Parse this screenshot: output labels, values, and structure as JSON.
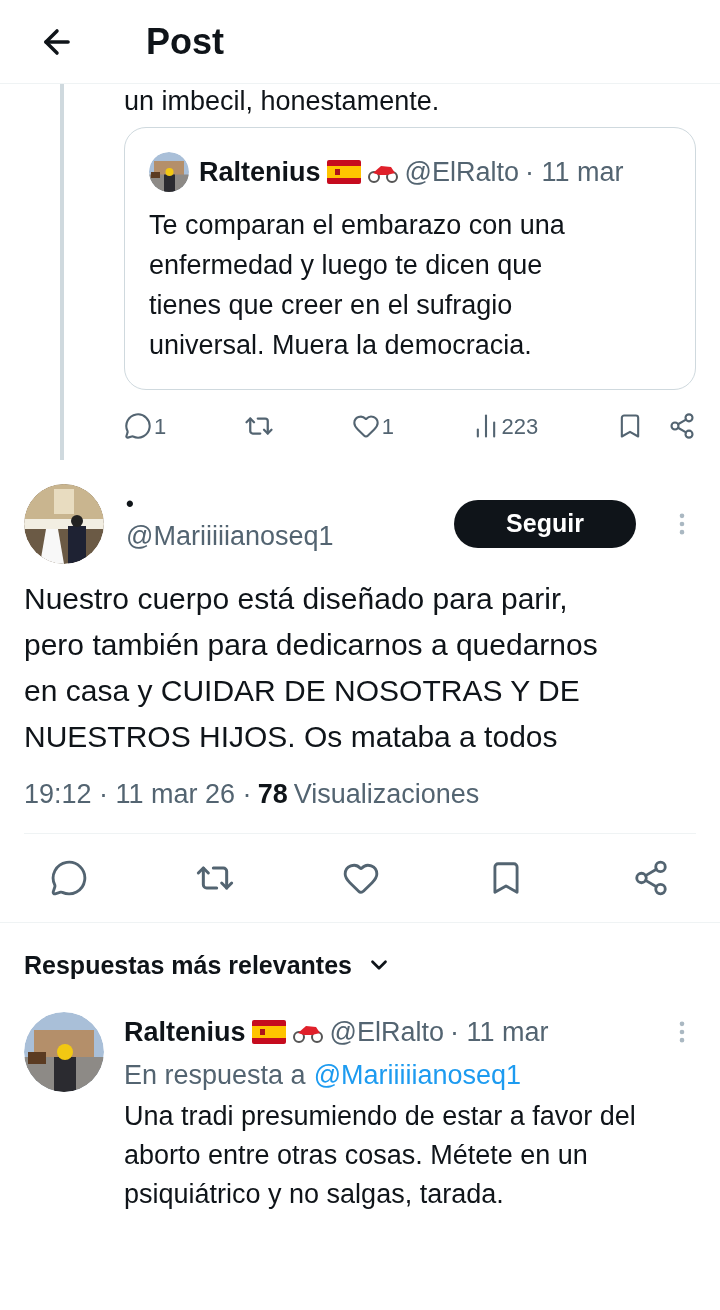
{
  "header": {
    "title": "Post"
  },
  "previous_post": {
    "cut_text": "un imbecil, honestamente.",
    "quote": {
      "name": "Raltenius",
      "handle": "@ElRalto",
      "date": "· 11 mar",
      "text": "Te comparan el embarazo con una enfermedad y luego te dicen que tienes que creer en el sufragio universal. Muera la democracia."
    },
    "actions": {
      "replies": "1",
      "likes": "1",
      "views": "223"
    }
  },
  "post": {
    "name": "•",
    "handle": "@Mariiiiianoseq1",
    "follow_button": "Seguir",
    "text": "Nuestro cuerpo está diseñado para parir, pero también para dedicarnos a quedarnos en casa y CUIDAR DE NOSOTRAS Y DE NUESTROS HIJOS. Os mataba a todos",
    "time": "19:12 · 11 mar 26 ·",
    "views_count": "78",
    "views_label": "Visualizaciones"
  },
  "replies_sort": {
    "label": "Respuestas más relevantes"
  },
  "reply": {
    "name": "Raltenius",
    "handle": "@ElRalto",
    "date": "· 11 mar",
    "reply_to_label": "En respuesta a",
    "reply_to_handle": "@Mariiiiianoseq1",
    "text": "Una tradi presumiendo de estar a favor del aborto entre otras cosas. Métete en un psiquiátrico y no salgas, tarada."
  }
}
